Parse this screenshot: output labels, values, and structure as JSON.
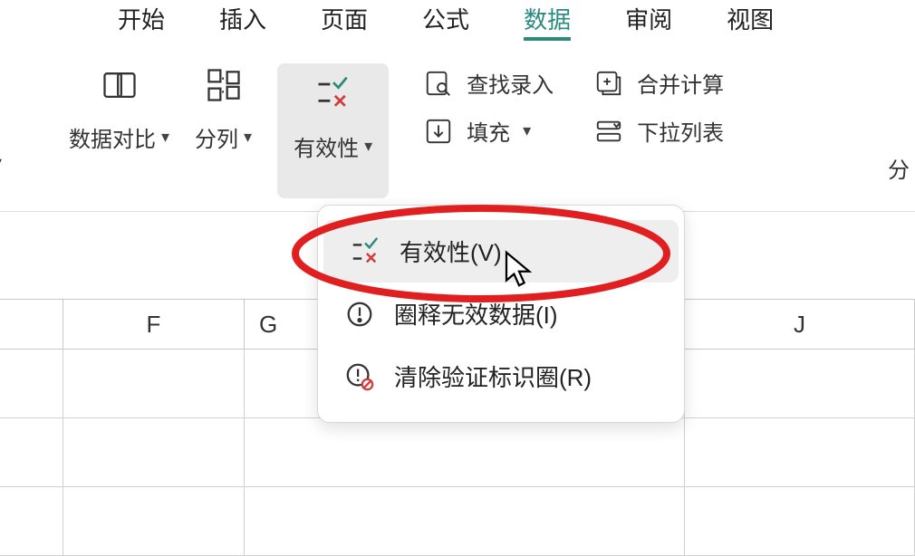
{
  "tabs": {
    "items": [
      {
        "label": "开始"
      },
      {
        "label": "插入"
      },
      {
        "label": "页面"
      },
      {
        "label": "公式"
      },
      {
        "label": "数据",
        "active": true
      },
      {
        "label": "审阅"
      },
      {
        "label": "视图"
      }
    ]
  },
  "ribbon": {
    "left_stub_chevron": "▾",
    "data_compare": "数据对比",
    "split_columns": "分列",
    "validity": "有效性",
    "find_input": "查找录入",
    "merge_calc": "合并计算",
    "fill": "填充",
    "dropdown_list": "下拉列表",
    "right_stub": "分"
  },
  "dropdown": {
    "items": [
      {
        "label": "有效性(V)",
        "hover": true
      },
      {
        "label": "圈释无效数据(I)"
      },
      {
        "label": "清除验证标识圈(R)"
      }
    ]
  },
  "sheet": {
    "column_headers": [
      "F",
      "G",
      "J"
    ]
  }
}
